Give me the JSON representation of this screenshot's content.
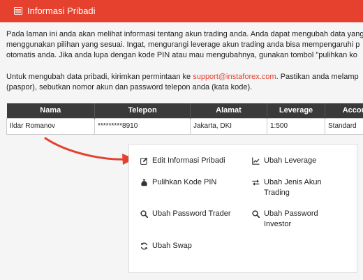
{
  "header": {
    "title": "Informasi Pribadi",
    "icon": "id-card-icon",
    "color": "#e5412e"
  },
  "intro": {
    "line1": "Pada laman ini anda akan melihat informasi tentang akun trading anda. Anda dapat mengubah data yang",
    "line2": "menggunakan pilihan yang sesuai. Ingat, mengurangi leverage akun trading anda bisa mempengaruhi p",
    "line3": "otomatis anda. Jika anda lupa dengan kode PIN atau mau mengubahnya, gunakan tombol \"pulihkan ko"
  },
  "contact": {
    "prefix": "Untuk mengubah data pribadi, kirimkan permintaan ke ",
    "email": "support@instaforex.com",
    "suffix": ". Pastikan anda melamp",
    "line2": "(paspor), sebutkan nomor akun dan password telepon anda (kata kode)."
  },
  "table": {
    "headers": [
      "Nama",
      "Telepon",
      "Alamat",
      "Leverage",
      "Accou"
    ],
    "row": [
      "Ildar Romanov",
      "*********8910",
      "Jakarta, DKI",
      "1:500",
      "Standard"
    ]
  },
  "actions": {
    "edit_info": "Edit Informasi Pribadi",
    "change_leverage": "Ubah Leverage",
    "recover_pin": "Pulihkan Kode PIN",
    "change_account_type": "Ubah Jenis Akun Trading",
    "change_trader_password": "Ubah Password Trader",
    "change_investor_password": "Ubah Password Investor",
    "change_swap": "Ubah Swap"
  },
  "colors": {
    "accent": "#e5412e",
    "table_header": "#3a3a3a"
  }
}
